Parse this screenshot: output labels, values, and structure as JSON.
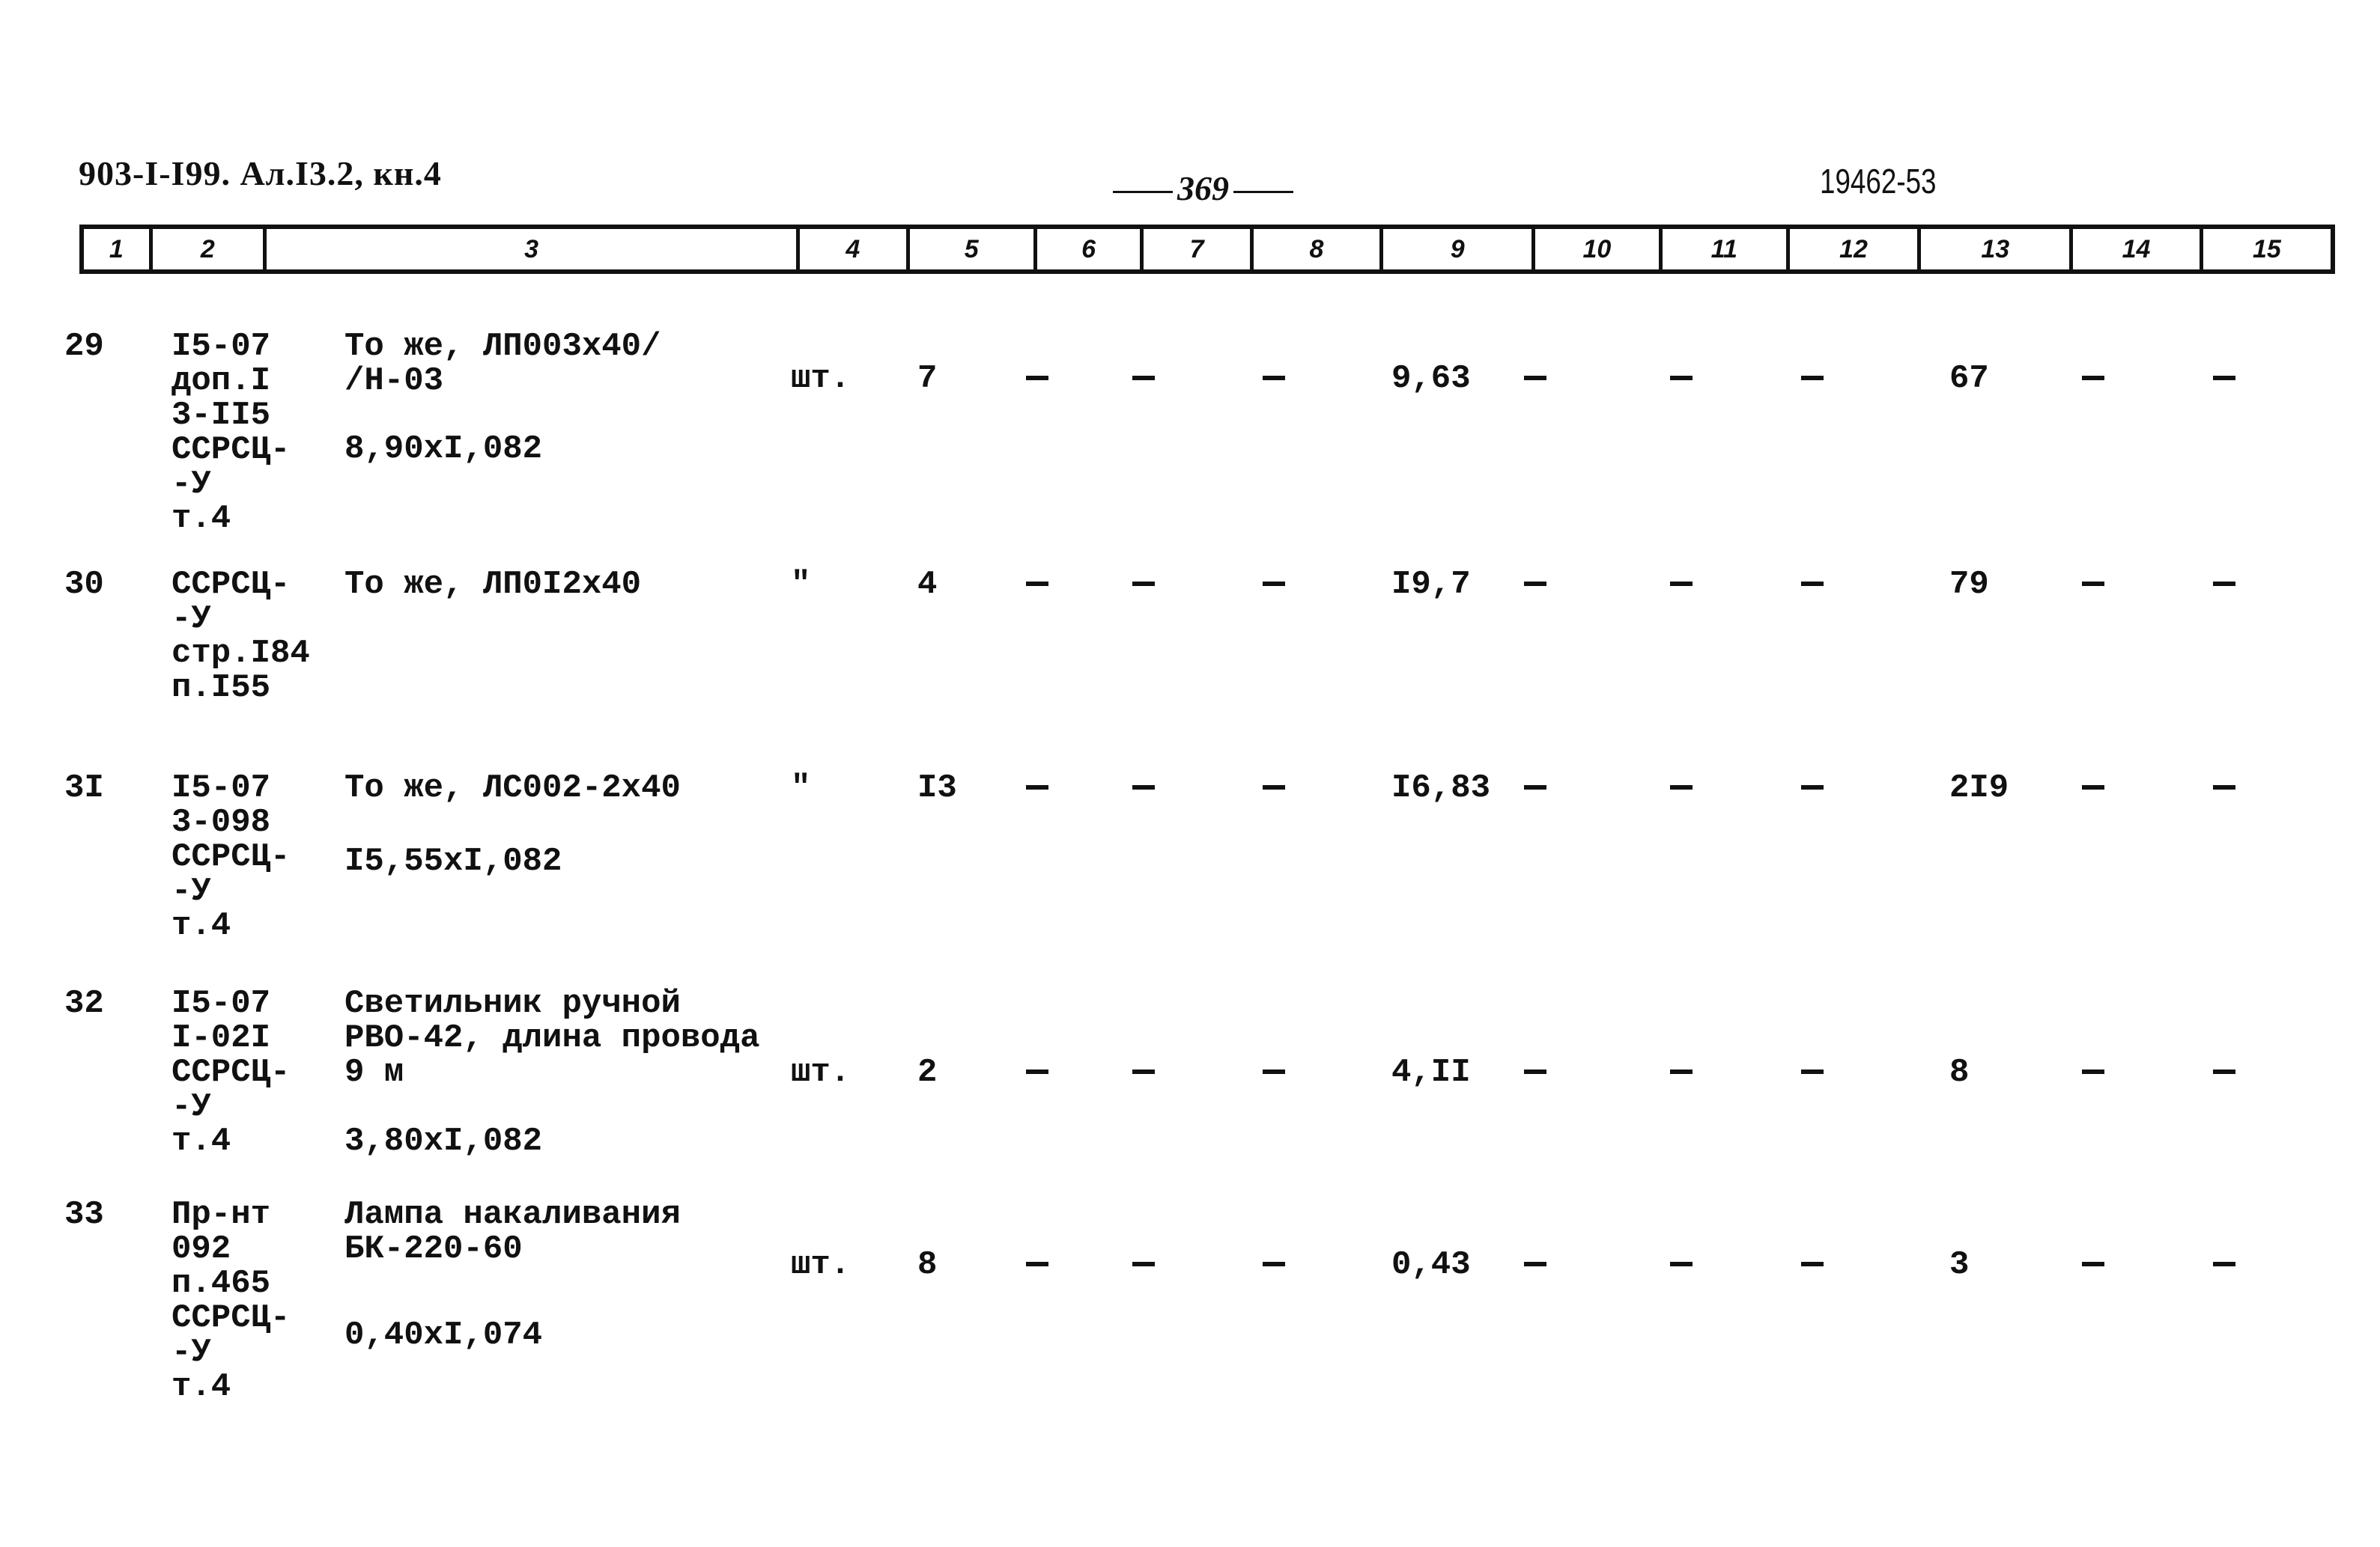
{
  "header": {
    "doc_code": "903-I-I99. Ал.I3.2, кн.4",
    "page_number": "369",
    "sheet_code": "19462-53"
  },
  "column_numbers": [
    "1",
    "2",
    "3",
    "4",
    "5",
    "6",
    "7",
    "8",
    "9",
    "10",
    "11",
    "12",
    "13",
    "14",
    "15"
  ],
  "rows": [
    {
      "num": "29",
      "ref": [
        "I5-07",
        "доп.I",
        "3-II5",
        "ССРСЦ-",
        "-У",
        "т.4"
      ],
      "desc": [
        "То же, ЛП003х40/",
        "/Н-03"
      ],
      "calc": "8,90хI,082",
      "unit": "шт.",
      "c5": "7",
      "c6": "-",
      "c7": "-",
      "c8": "-",
      "c9": "9,63",
      "c10": "-",
      "c11": "-",
      "c12": "-",
      "c13": "67",
      "c14": "-",
      "c15": "-"
    },
    {
      "num": "30",
      "ref": [
        "ССРСЦ-",
        "-У",
        "стр.I84",
        "п.I55"
      ],
      "desc": [
        "То же, ЛП0I2х40"
      ],
      "calc": "",
      "unit": "\"",
      "c5": "4",
      "c6": "-",
      "c7": "-",
      "c8": "-",
      "c9": "I9,7",
      "c10": "-",
      "c11": "-",
      "c12": "-",
      "c13": "79",
      "c14": "-",
      "c15": "-"
    },
    {
      "num": "3I",
      "ref": [
        "I5-07",
        "3-098",
        "ССРСЦ-",
        "-У",
        "т.4"
      ],
      "desc": [
        "То же, ЛС002-2х40"
      ],
      "calc": "I5,55хI,082",
      "unit": "\"",
      "c5": "I3",
      "c6": "-",
      "c7": "-",
      "c8": "-",
      "c9": "I6,83",
      "c10": "-",
      "c11": "-",
      "c12": "-",
      "c13": "2I9",
      "c14": "-",
      "c15": "-"
    },
    {
      "num": "32",
      "ref": [
        "I5-07",
        "I-02I",
        "ССРСЦ-",
        "-У",
        "т.4"
      ],
      "desc": [
        "Светильник ручной",
        "РВО-42, длина провода",
        "9 м"
      ],
      "calc": "3,80хI,082",
      "unit": "шт.",
      "c5": "2",
      "c6": "-",
      "c7": "-",
      "c8": "-",
      "c9": "4,II",
      "c10": "-",
      "c11": "-",
      "c12": "-",
      "c13": "8",
      "c14": "-",
      "c15": "-"
    },
    {
      "num": "33",
      "ref": [
        "Пр-нт",
        "092",
        "п.465",
        "ССРСЦ-",
        "-У",
        "т.4"
      ],
      "desc": [
        "Лампа накаливания",
        "БК-220-60"
      ],
      "calc": "0,40хI,074",
      "unit": "шт.",
      "c5": "8",
      "c6": "-",
      "c7": "-",
      "c8": "-",
      "c9": "0,43",
      "c10": "-",
      "c11": "-",
      "c12": "-",
      "c13": "3",
      "c14": "-",
      "c15": "-"
    }
  ]
}
